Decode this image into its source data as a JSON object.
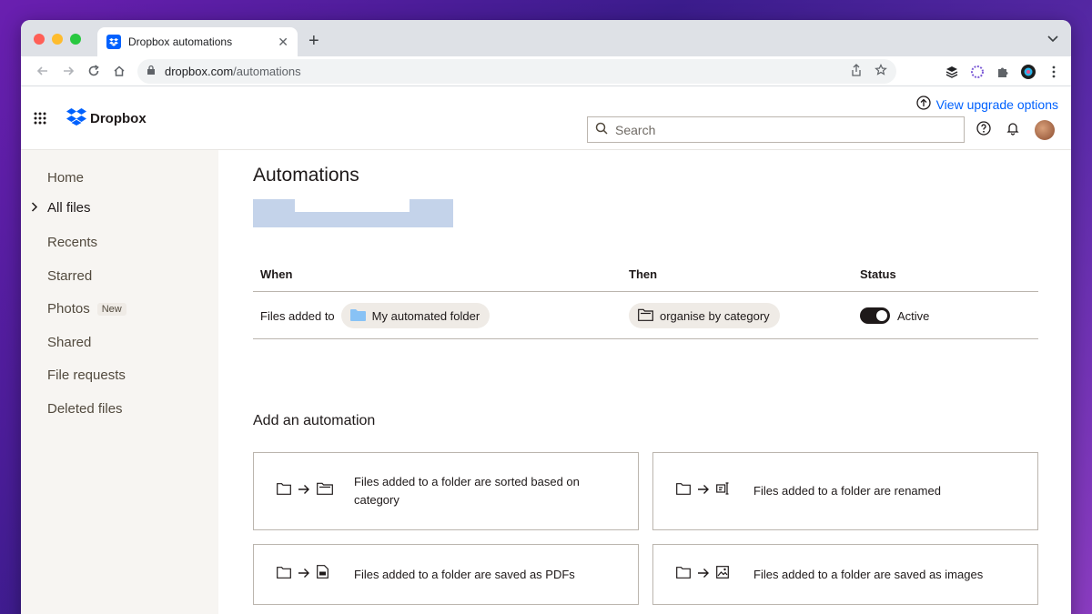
{
  "browser": {
    "tab_title": "Dropbox automations",
    "url_host": "dropbox.com",
    "url_path": "/automations"
  },
  "header": {
    "logo_text": "Dropbox",
    "upgrade_label": "View upgrade options",
    "search_placeholder": "Search"
  },
  "sidebar": {
    "items": [
      {
        "label": "Home"
      },
      {
        "label": "All files"
      },
      {
        "label": "Recents"
      },
      {
        "label": "Starred"
      },
      {
        "label": "Photos",
        "badge": "New"
      },
      {
        "label": "Shared"
      },
      {
        "label": "File requests"
      },
      {
        "label": "Deleted files"
      }
    ]
  },
  "main": {
    "title": "Automations",
    "table": {
      "headers": {
        "when": "When",
        "then": "Then",
        "status": "Status"
      },
      "rows": [
        {
          "when_prefix": "Files added to",
          "folder": "My automated folder",
          "then": "organise by category",
          "status": "Active"
        }
      ]
    },
    "add_title": "Add an automation",
    "cards": [
      {
        "label": "Files added to a folder are sorted based on category"
      },
      {
        "label": "Files added to a folder are renamed"
      },
      {
        "label": "Files added to a folder are saved as PDFs"
      },
      {
        "label": "Files added to a folder are saved as images"
      }
    ]
  },
  "colors": {
    "accent": "#0061fe",
    "sidebar_bg": "#f7f5f2",
    "chip_bg": "#efebe6",
    "folder_blue": "#88c2f5"
  }
}
